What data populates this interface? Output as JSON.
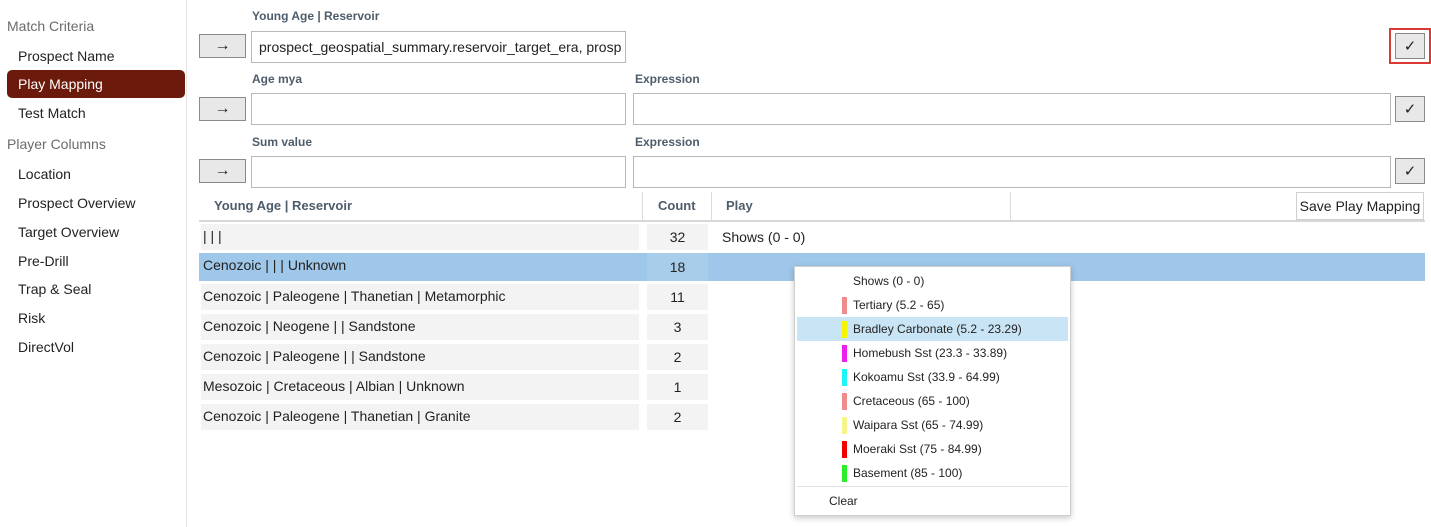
{
  "sidebar": {
    "match_criteria": "Match Criteria",
    "items_top": [
      "Prospect Name",
      "Play Mapping",
      "Test Match"
    ],
    "player_columns": "Player Columns",
    "items_bottom": [
      "Location",
      "Prospect Overview",
      "Target Overview",
      "Pre-Drill",
      "Trap & Seal",
      "Risk",
      "DirectVol"
    ]
  },
  "form": {
    "row1": {
      "label": "Young Age | Reservoir",
      "value": "prospect_geospatial_summary.reservoir_target_era, prosp"
    },
    "row2": {
      "label_left": "Age mya",
      "label_right": "Expression",
      "value_left": "",
      "value_right": ""
    },
    "row3": {
      "label_left": "Sum value",
      "label_right": "Expression",
      "value_left": "",
      "value_right": ""
    },
    "arrow_icon": "→",
    "check_icon": "✓"
  },
  "table": {
    "headers": [
      "Young Age | Reservoir",
      "Count",
      "Play"
    ],
    "save_label": "Save Play Mapping",
    "rows": [
      {
        "reservoir": "| | |",
        "count": "32",
        "play": "Shows (0 - 0)"
      },
      {
        "reservoir": "Cenozoic | | | Unknown",
        "count": "18",
        "play": ""
      },
      {
        "reservoir": "Cenozoic | Paleogene | Thanetian | Metamorphic",
        "count": "11",
        "play": ""
      },
      {
        "reservoir": "Cenozoic | Neogene | | Sandstone",
        "count": "3",
        "play": ""
      },
      {
        "reservoir": "Cenozoic | Paleogene | | Sandstone",
        "count": "2",
        "play": ""
      },
      {
        "reservoir": "Mesozoic | Cretaceous | Albian | Unknown",
        "count": "1",
        "play": ""
      },
      {
        "reservoir": "Cenozoic | Paleogene | Thanetian | Granite",
        "count": "2",
        "play": ""
      }
    ]
  },
  "dropdown": {
    "options": [
      {
        "label": "Shows (0 - 0)",
        "color": ""
      },
      {
        "label": "Tertiary (5.2 - 65)",
        "color": "#f08c8c"
      },
      {
        "label": "Bradley Carbonate (5.2 - 23.29)",
        "color": "#f5f500"
      },
      {
        "label": "Homebush Sst (23.3 - 33.89)",
        "color": "#f01ef0"
      },
      {
        "label": "Kokoamu Sst (33.9 - 64.99)",
        "color": "#1ef5f5"
      },
      {
        "label": "Cretaceous (65 - 100)",
        "color": "#f08c8c"
      },
      {
        "label": "Waipara Sst (65 - 74.99)",
        "color": "#f5f58c"
      },
      {
        "label": "Moeraki Sst (75 - 84.99)",
        "color": "#f00000"
      },
      {
        "label": "Basement (85 - 100)",
        "color": "#28f028"
      }
    ],
    "clear_label": "Clear"
  },
  "colors": {
    "accent_active_nav": "#6b1a0c",
    "selected_row": "#9ec7ea",
    "highlight_option": "#c9e4f5",
    "focus_outline": "#d93a33"
  }
}
